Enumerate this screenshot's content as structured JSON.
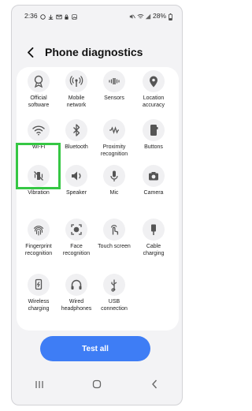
{
  "status_bar": {
    "time": "2:36",
    "battery": "28%"
  },
  "header": {
    "title": "Phone diagnostics",
    "back_icon": "chevron-left-icon"
  },
  "diagnostics": {
    "items": [
      {
        "id": "official-software",
        "label": "Official\nsoftware",
        "icon": "badge-icon"
      },
      {
        "id": "mobile-network",
        "label": "Mobile\nnetwork",
        "icon": "antenna-icon"
      },
      {
        "id": "sensors",
        "label": "Sensors",
        "icon": "sensor-wave-icon"
      },
      {
        "id": "location-accuracy",
        "label": "Location\naccuracy",
        "icon": "location-pin-icon"
      },
      {
        "id": "wifi",
        "label": "Wi-Fi",
        "icon": "wifi-icon"
      },
      {
        "id": "bluetooth",
        "label": "Bluetooth",
        "icon": "bluetooth-icon"
      },
      {
        "id": "proximity-recognition",
        "label": "Proximity\nrecognition",
        "icon": "proximity-icon"
      },
      {
        "id": "buttons",
        "label": "Buttons",
        "icon": "side-buttons-icon"
      },
      {
        "id": "vibration",
        "label": "Vibration",
        "icon": "vibration-off-icon"
      },
      {
        "id": "speaker",
        "label": "Speaker",
        "icon": "speaker-icon"
      },
      {
        "id": "mic",
        "label": "Mic",
        "icon": "microphone-icon"
      },
      {
        "id": "camera",
        "label": "Camera",
        "icon": "camera-icon"
      },
      {
        "id": "fingerprint-recognition",
        "label": "Fingerprint\nrecognition",
        "icon": "fingerprint-icon"
      },
      {
        "id": "face-recognition",
        "label": "Face\nrecognition",
        "icon": "face-scan-icon"
      },
      {
        "id": "touch-screen",
        "label": "Touch screen",
        "icon": "touch-hand-icon"
      },
      {
        "id": "cable-charging",
        "label": "Cable\ncharging",
        "icon": "cable-plug-icon"
      },
      {
        "id": "wireless-charging",
        "label": "Wireless\ncharging",
        "icon": "wireless-charging-icon"
      },
      {
        "id": "wired-headphones",
        "label": "Wired\nheadphones",
        "icon": "headphones-icon"
      },
      {
        "id": "usb-connection",
        "label": "USB\nconnection",
        "icon": "usb-icon"
      }
    ]
  },
  "actions": {
    "test_all": "Test all"
  },
  "colors": {
    "accent": "#3e7df5",
    "highlight": "#36c744",
    "background": "#f3f3f5",
    "icon_bg": "#f0f0f2"
  }
}
